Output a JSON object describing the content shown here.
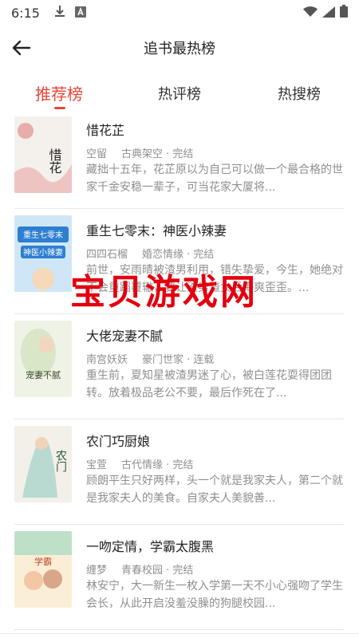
{
  "status_bar": {
    "time": "6:15",
    "icons": [
      "download-icon",
      "a-box-icon",
      "wifi-icon",
      "signal-icon",
      "battery-icon"
    ]
  },
  "header": {
    "title": "追书最热榜"
  },
  "tabs": [
    {
      "label": "推荐榜",
      "active": true
    },
    {
      "label": "热评榜",
      "active": false
    },
    {
      "label": "热搜榜",
      "active": false
    }
  ],
  "books": [
    {
      "title": "惜花芷",
      "author": "空留",
      "category": "古典架空 · 完结",
      "desc": "藏拙十五年，花芷原以为自己可以做一个最合格的世家千金安稳一辈子，可当花家大厦将...",
      "cover_text": "惜花芷"
    },
    {
      "title": "重生七零末：神医小辣妻",
      "author": "四四石榴",
      "category": "婚恋情缘 · 完结",
      "desc": "前世，安雨晴被渣男利用，错失挚爱，今生，她绝对不会重蹈覆辙，要让渣男渣女后悔爽歪歪。...",
      "cover_text": "重生七零末 神医小辣妻"
    },
    {
      "title": "大佬宠妻不腻",
      "author": "南宫妖妖",
      "category": "豪门世家 · 连载",
      "desc": "重生前，夏知星被渣男迷了心，被白莲花耍得团团转。放着极品老公不要，最后作死在了...",
      "cover_text": "宠妻不腻"
    },
    {
      "title": "农门巧厨娘",
      "author": "宝萱",
      "category": "古代情缘 · 完结",
      "desc": "顾朗平生只好两样，头一个就是我家夫人，第二个就是我家夫人的美食。自家夫人美貌善...",
      "cover_text": "农门巧厨娘"
    },
    {
      "title": "一吻定情，学霸太腹黑",
      "author": "缠梦",
      "category": "青春校园 · 完结",
      "desc": "林安宁，大一新生一枚入学第一天不小心强吻了学生会长，从此开启没羞没臊的狗腿校园...",
      "cover_text": "学霸太腹黑"
    }
  ],
  "watermark": "宝贝游戏网",
  "colors": {
    "accent": "#e4463a",
    "watermark": "#e3000f",
    "muted_text": "#8f8f8f"
  }
}
